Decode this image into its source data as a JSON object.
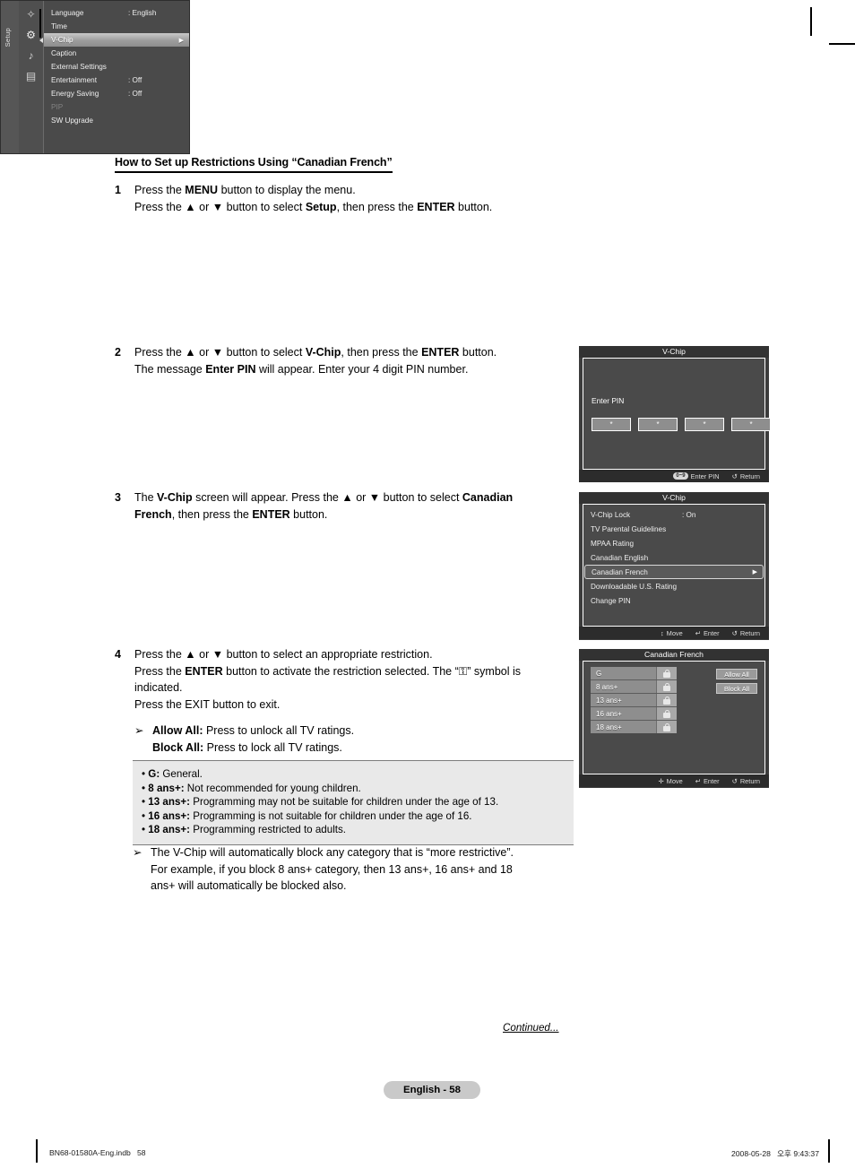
{
  "document": {
    "section_title": "How to Set up Restrictions Using “Canadian French”",
    "continued_label": "Continued...",
    "page_badge": "English - 58",
    "footer_left": "BN68-01580A-Eng.indb   58",
    "footer_right": "2008-05-28   오후 9:43:37"
  },
  "steps": [
    {
      "number": "1",
      "lines": [
        "Press the MENU button to display the menu.",
        "Press the ▲ or ▼ button to select Setup, then press the ENTER button."
      ]
    },
    {
      "number": "2",
      "lines": [
        "Press the ▲ or ▼ button to select V-Chip, then press the ENTER button.",
        "The message Enter PIN will appear. Enter your 4 digit PIN number."
      ]
    },
    {
      "number": "3",
      "lines": [
        "The V-Chip screen will appear. Press the ▲ or ▼ button to select Canadian",
        "French, then press the ENTER button."
      ]
    },
    {
      "number": "4",
      "lines": [
        "Press the ▲ or ▼ button to select an appropriate restriction.",
        "Press the ENTER button to activate the restriction selected. The “ ” symbol is",
        "indicated."
      ],
      "exit_line": "Press the EXIT button to exit.",
      "bullet": {
        "arrow": "➢",
        "line1_bold": "Allow All:",
        "line1_rest": " Press to unlock all TV ratings.",
        "line2_bold": "Block All:",
        "line2_rest": " Press to lock all TV ratings."
      }
    }
  ],
  "rating_notes": [
    {
      "bullet": "•",
      "term": "G:",
      "desc": " General."
    },
    {
      "bullet": "•",
      "term": "8 ans+:",
      "desc": " Not recommended for young children."
    },
    {
      "bullet": "•",
      "term": "13 ans+:",
      "desc": " Programming may not be suitable for children under the age of 13."
    },
    {
      "bullet": "•",
      "term": "16 ans+:",
      "desc": " Programming is not suitable for children under the age of 16."
    },
    {
      "bullet": "•",
      "term": "18 ans+:",
      "desc": " Programming restricted to adults."
    }
  ],
  "final_note": {
    "arrow": "➢",
    "lines": [
      "The V-Chip will automatically block any category that is “more restrictive”.",
      "For example, if you block 8 ans+ category, then 13 ans+, 16 ans+ and 18",
      "ans+ will automatically be blocked also."
    ]
  },
  "osd_panels": {
    "setup": {
      "vertical_tab_label": "Setup",
      "icons": [
        "picture-icon",
        "gear-icon",
        "sound-icon",
        "input-icon"
      ],
      "rows": [
        {
          "label": "Language",
          "value": ": English",
          "state": "normal"
        },
        {
          "label": "Time",
          "value": "",
          "state": "normal"
        },
        {
          "label": "V-Chip",
          "value": "",
          "state": "selected",
          "arrow": "▶"
        },
        {
          "label": "Caption",
          "value": "",
          "state": "normal"
        },
        {
          "label": "External Settings",
          "value": "",
          "state": "normal"
        },
        {
          "label": "Entertainment",
          "value": ": Off",
          "state": "normal"
        },
        {
          "label": "Energy Saving",
          "value": ": Off",
          "state": "normal"
        },
        {
          "label": "PIP",
          "value": "",
          "state": "dim"
        },
        {
          "label": "SW Upgrade",
          "value": "",
          "state": "normal"
        }
      ]
    },
    "pin": {
      "title": "V-Chip",
      "prompt": "Enter PIN",
      "pin_digits": [
        "*",
        "*",
        "*",
        "*"
      ],
      "footer": [
        {
          "keycap": "0~9",
          "label": "Enter PIN"
        },
        {
          "icon": "↺",
          "label": "Return"
        }
      ]
    },
    "vchip": {
      "title": "V-Chip",
      "rows": [
        {
          "label": "V-Chip Lock",
          "value": ": On",
          "state": "normal"
        },
        {
          "label": "TV Parental Guidelines",
          "value": "",
          "state": "normal"
        },
        {
          "label": "MPAA Rating",
          "value": "",
          "state": "normal"
        },
        {
          "label": "Canadian English",
          "value": "",
          "state": "normal"
        },
        {
          "label": "Canadian French",
          "value": "",
          "state": "selected",
          "arrow": "▶"
        },
        {
          "label": "Downloadable U.S. Rating",
          "value": "",
          "state": "normal"
        },
        {
          "label": "Change PIN",
          "value": "",
          "state": "normal"
        }
      ],
      "footer": [
        {
          "icon": "↕",
          "label": "Move"
        },
        {
          "icon": "↵",
          "label": "Enter"
        },
        {
          "icon": "↺",
          "label": "Return"
        }
      ]
    },
    "canadian_french": {
      "title": "Canadian French",
      "ratings": [
        "G",
        "8 ans+",
        "13 ans+",
        "16 ans+",
        "18 ans+"
      ],
      "buttons": [
        "Allow All",
        "Block All"
      ],
      "footer": [
        {
          "icon": "✛",
          "label": "Move"
        },
        {
          "icon": "↵",
          "label": "Enter"
        },
        {
          "icon": "↺",
          "label": "Return"
        }
      ]
    }
  },
  "colors": {
    "osd_background": "#3c3c3c",
    "osd_panel": "#4a4a4a",
    "osd_selected": "#9d9d9d",
    "note_box": "#e9e9e9",
    "page_badge": "#c9c9c9"
  }
}
